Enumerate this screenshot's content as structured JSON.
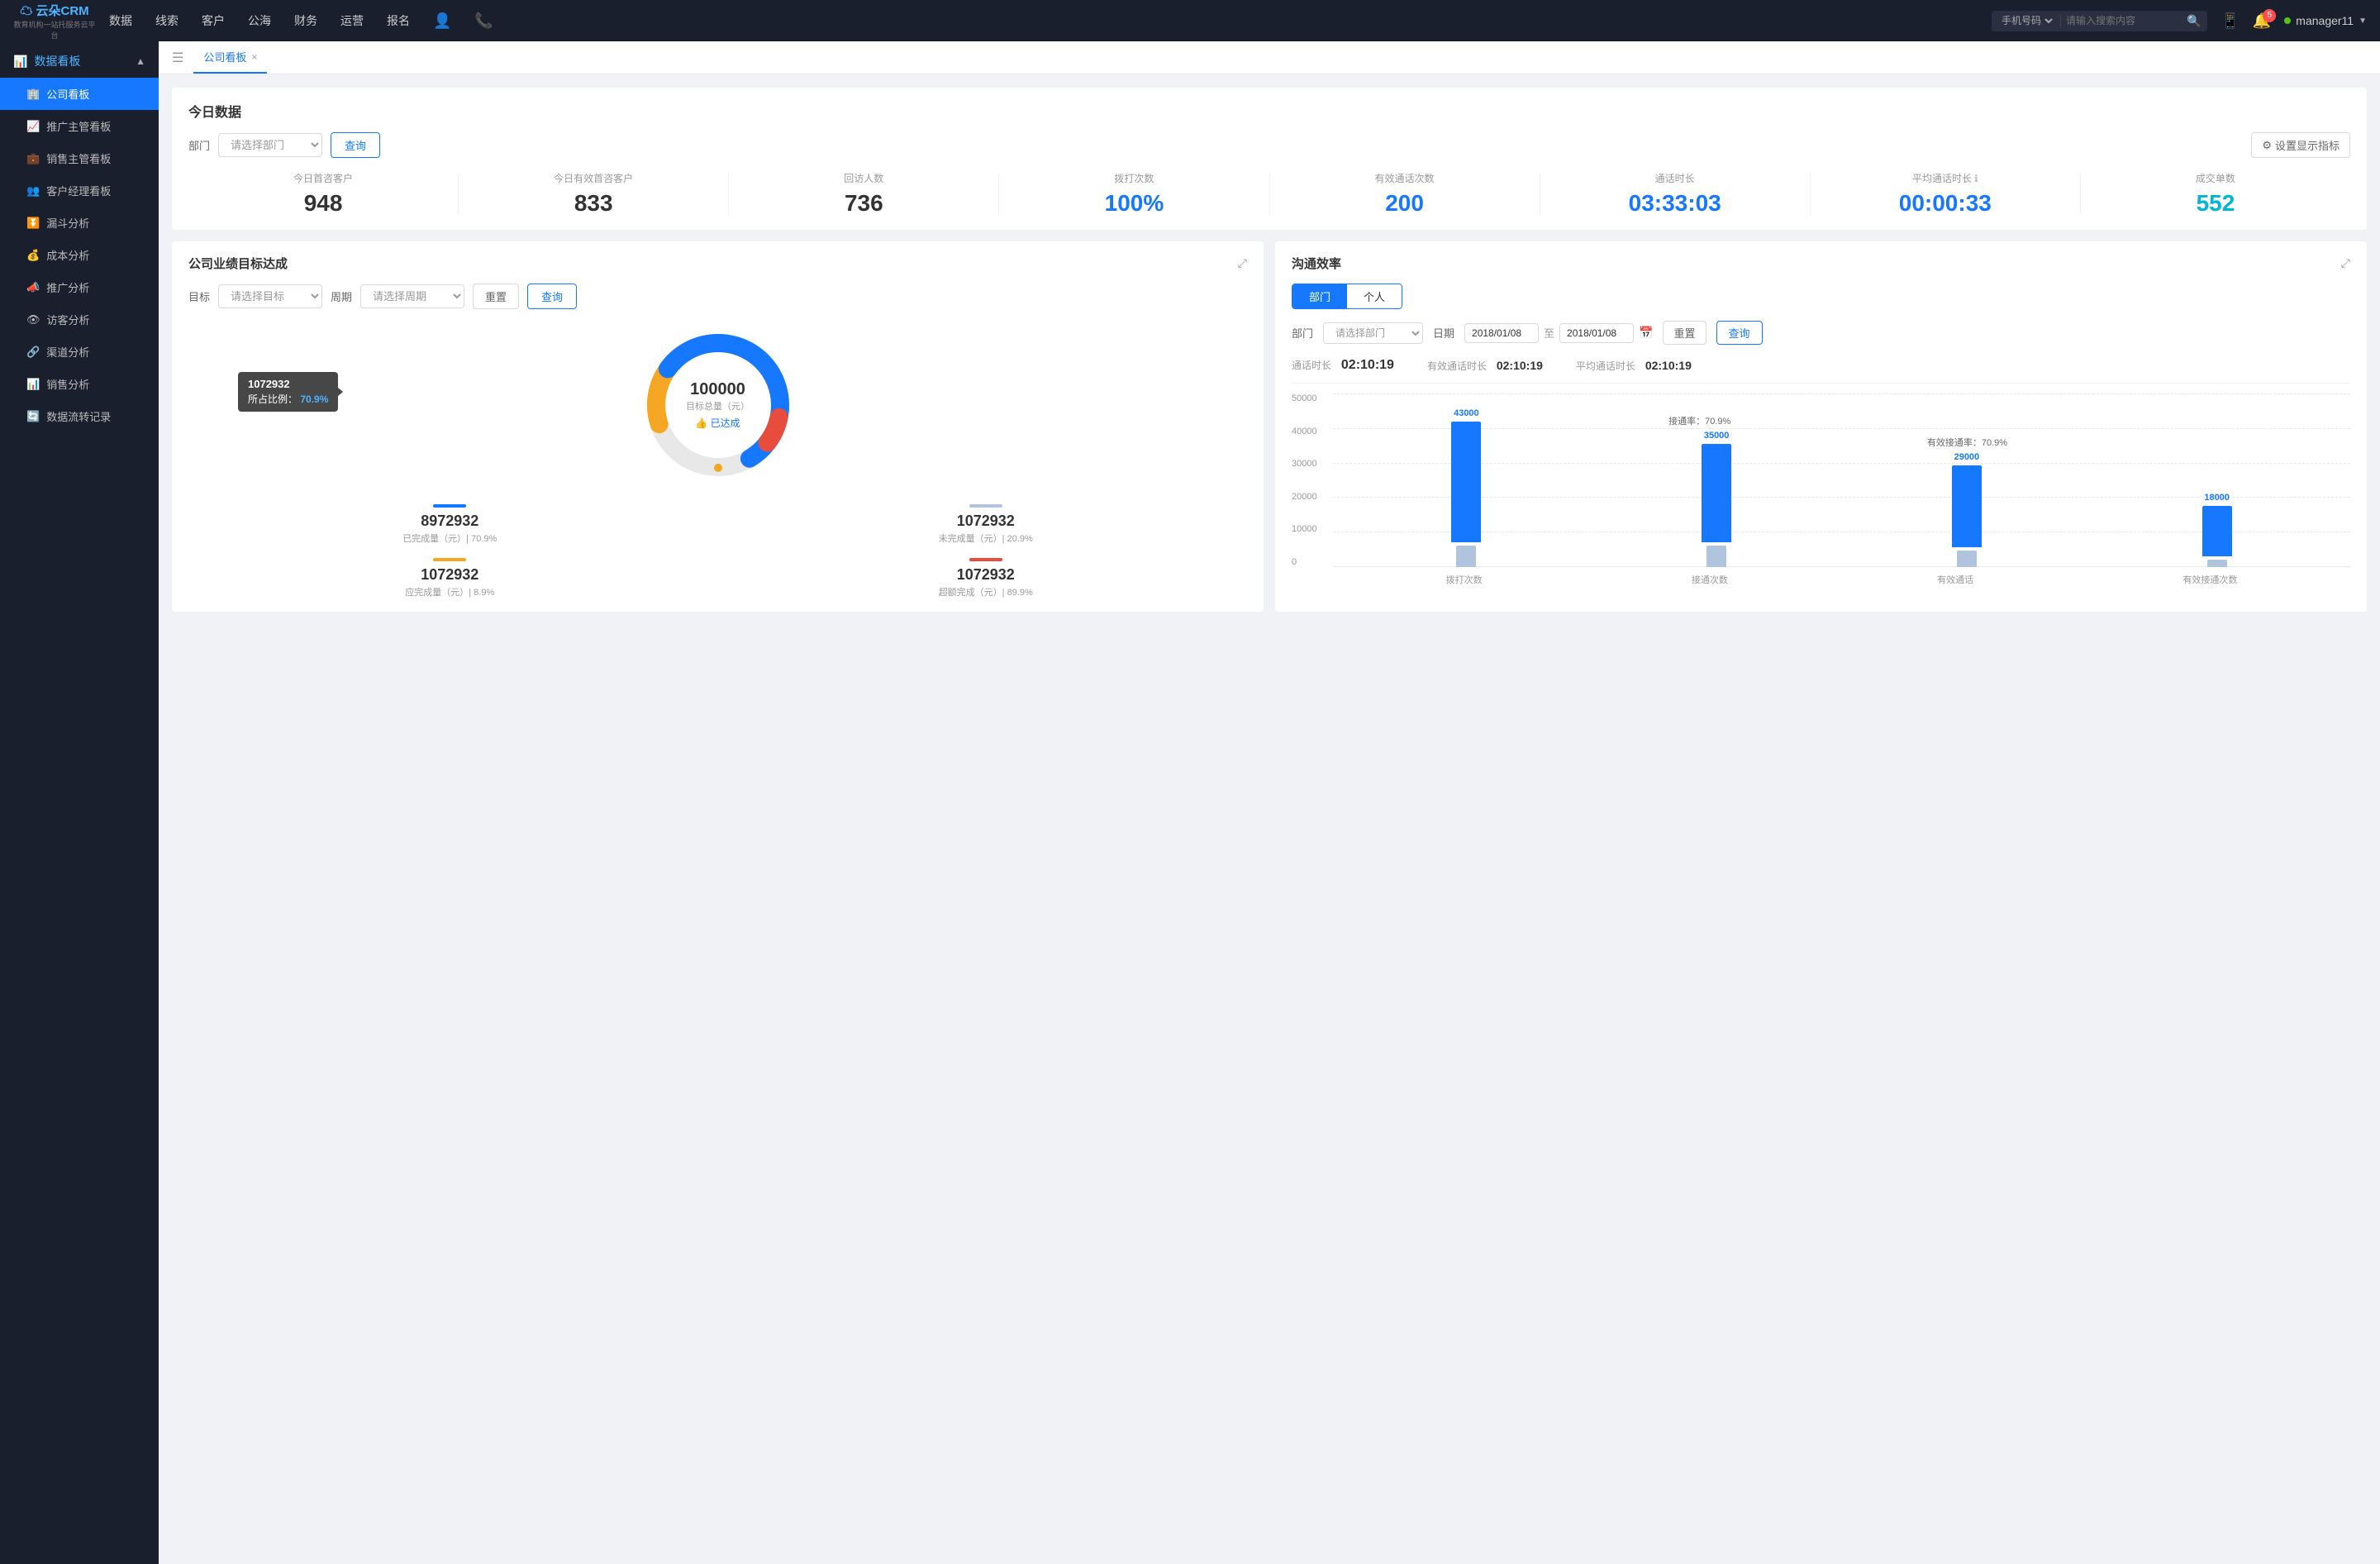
{
  "app": {
    "logo_top": "云朵CRM",
    "logo_bottom": "教育机构一站\n托服务云平台"
  },
  "nav": {
    "items": [
      "数据",
      "线索",
      "客户",
      "公海",
      "财务",
      "运营",
      "报名"
    ]
  },
  "search": {
    "select_label": "手机号码",
    "placeholder": "请输入搜索内容"
  },
  "notification": {
    "badge": "5"
  },
  "user": {
    "name": "manager11"
  },
  "sidebar": {
    "section_title": "数据看板",
    "items": [
      {
        "label": "公司看板",
        "active": true
      },
      {
        "label": "推广主管看板",
        "active": false
      },
      {
        "label": "销售主管看板",
        "active": false
      },
      {
        "label": "客户经理看板",
        "active": false
      },
      {
        "label": "漏斗分析",
        "active": false
      },
      {
        "label": "成本分析",
        "active": false
      },
      {
        "label": "推广分析",
        "active": false
      },
      {
        "label": "访客分析",
        "active": false
      },
      {
        "label": "渠道分析",
        "active": false
      },
      {
        "label": "销售分析",
        "active": false
      },
      {
        "label": "数据流转记录",
        "active": false
      }
    ]
  },
  "tab": {
    "label": "公司看板",
    "close": "×"
  },
  "today": {
    "title": "今日数据",
    "filter_label": "部门",
    "filter_placeholder": "请选择部门",
    "query_btn": "查询",
    "settings_btn": "设置显示指标",
    "metrics": [
      {
        "label": "今日首咨客户",
        "value": "948",
        "color": "black"
      },
      {
        "label": "今日有效首咨客户",
        "value": "833",
        "color": "black"
      },
      {
        "label": "回访人数",
        "value": "736",
        "color": "black"
      },
      {
        "label": "拨打次数",
        "value": "100%",
        "color": "blue"
      },
      {
        "label": "有效通话次数",
        "value": "200",
        "color": "blue"
      },
      {
        "label": "通话时长",
        "value": "03:33:03",
        "color": "blue"
      },
      {
        "label": "平均通话时长",
        "value": "00:00:33",
        "color": "cyan"
      },
      {
        "label": "成交单数",
        "value": "552",
        "color": "cyan"
      }
    ]
  },
  "target_panel": {
    "title": "公司业绩目标达成",
    "target_label": "目标",
    "target_placeholder": "请选择目标",
    "period_label": "周期",
    "period_placeholder": "请选择周期",
    "reset_btn": "重置",
    "query_btn": "查询",
    "donut": {
      "value": "100000",
      "sub_label": "目标总量（元）",
      "badge": "👍 已达成",
      "tooltip_value": "1072932",
      "tooltip_percent_label": "所占比例：",
      "tooltip_percent": "70.9%"
    },
    "metrics": [
      {
        "indicator_color": "#1677ff",
        "value": "8972932",
        "label": "已完成量（元）| 70.9%"
      },
      {
        "indicator_color": "#b0c4de",
        "value": "1072932",
        "label": "未完成量（元）| 20.9%"
      },
      {
        "indicator_color": "#f5a623",
        "value": "1072932",
        "label": "应完成量（元）| 8.9%"
      },
      {
        "indicator_color": "#e74c3c",
        "value": "1072932",
        "label": "超额完成（元）| 89.9%"
      }
    ]
  },
  "efficiency_panel": {
    "title": "沟通效率",
    "tab_dept": "部门",
    "tab_personal": "个人",
    "dept_label": "部门",
    "dept_placeholder": "请选择部门",
    "date_label": "日期",
    "date_start": "2018/01/08",
    "date_end": "2018/01/08",
    "reset_btn": "重置",
    "query_btn": "查询",
    "call_stats": [
      {
        "label": "通话时长",
        "value": "02:10:19"
      },
      {
        "label": "有效通话时长",
        "value": "02:10:19"
      },
      {
        "label": "平均通话时长",
        "value": "02:10:19"
      }
    ],
    "chart": {
      "y_labels": [
        "50000",
        "40000",
        "30000",
        "20000",
        "10000",
        "0"
      ],
      "bars": [
        {
          "label": "拨打次数",
          "value1": 43000,
          "value1_label": "43000",
          "value2": 0,
          "rate_label": null
        },
        {
          "label": "接通次数",
          "value1": 35000,
          "value1_label": "35000",
          "value2": 0,
          "rate_label": "接通率：70.9%"
        },
        {
          "label": "有效通话",
          "value1": 29000,
          "value1_label": "29000",
          "value2": 0,
          "rate_label": "有效接通率：70.9%"
        },
        {
          "label": "有效接通次数",
          "value1": 18000,
          "value1_label": "18000",
          "value2": 0,
          "rate_label": null
        }
      ]
    }
  }
}
